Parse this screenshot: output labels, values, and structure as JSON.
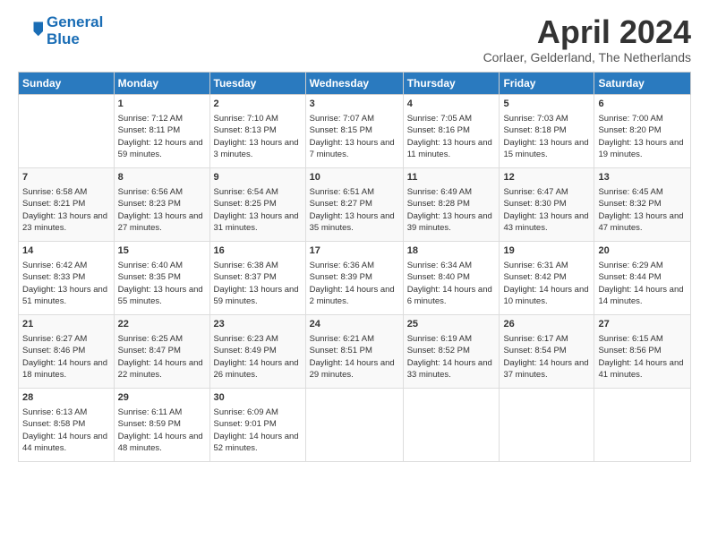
{
  "header": {
    "logo_line1": "General",
    "logo_line2": "Blue",
    "month_title": "April 2024",
    "subtitle": "Corlaer, Gelderland, The Netherlands"
  },
  "days_of_week": [
    "Sunday",
    "Monday",
    "Tuesday",
    "Wednesday",
    "Thursday",
    "Friday",
    "Saturday"
  ],
  "weeks": [
    [
      {
        "day": "",
        "sunrise": "",
        "sunset": "",
        "daylight": ""
      },
      {
        "day": "1",
        "sunrise": "Sunrise: 7:12 AM",
        "sunset": "Sunset: 8:11 PM",
        "daylight": "Daylight: 12 hours and 59 minutes."
      },
      {
        "day": "2",
        "sunrise": "Sunrise: 7:10 AM",
        "sunset": "Sunset: 8:13 PM",
        "daylight": "Daylight: 13 hours and 3 minutes."
      },
      {
        "day": "3",
        "sunrise": "Sunrise: 7:07 AM",
        "sunset": "Sunset: 8:15 PM",
        "daylight": "Daylight: 13 hours and 7 minutes."
      },
      {
        "day": "4",
        "sunrise": "Sunrise: 7:05 AM",
        "sunset": "Sunset: 8:16 PM",
        "daylight": "Daylight: 13 hours and 11 minutes."
      },
      {
        "day": "5",
        "sunrise": "Sunrise: 7:03 AM",
        "sunset": "Sunset: 8:18 PM",
        "daylight": "Daylight: 13 hours and 15 minutes."
      },
      {
        "day": "6",
        "sunrise": "Sunrise: 7:00 AM",
        "sunset": "Sunset: 8:20 PM",
        "daylight": "Daylight: 13 hours and 19 minutes."
      }
    ],
    [
      {
        "day": "7",
        "sunrise": "Sunrise: 6:58 AM",
        "sunset": "Sunset: 8:21 PM",
        "daylight": "Daylight: 13 hours and 23 minutes."
      },
      {
        "day": "8",
        "sunrise": "Sunrise: 6:56 AM",
        "sunset": "Sunset: 8:23 PM",
        "daylight": "Daylight: 13 hours and 27 minutes."
      },
      {
        "day": "9",
        "sunrise": "Sunrise: 6:54 AM",
        "sunset": "Sunset: 8:25 PM",
        "daylight": "Daylight: 13 hours and 31 minutes."
      },
      {
        "day": "10",
        "sunrise": "Sunrise: 6:51 AM",
        "sunset": "Sunset: 8:27 PM",
        "daylight": "Daylight: 13 hours and 35 minutes."
      },
      {
        "day": "11",
        "sunrise": "Sunrise: 6:49 AM",
        "sunset": "Sunset: 8:28 PM",
        "daylight": "Daylight: 13 hours and 39 minutes."
      },
      {
        "day": "12",
        "sunrise": "Sunrise: 6:47 AM",
        "sunset": "Sunset: 8:30 PM",
        "daylight": "Daylight: 13 hours and 43 minutes."
      },
      {
        "day": "13",
        "sunrise": "Sunrise: 6:45 AM",
        "sunset": "Sunset: 8:32 PM",
        "daylight": "Daylight: 13 hours and 47 minutes."
      }
    ],
    [
      {
        "day": "14",
        "sunrise": "Sunrise: 6:42 AM",
        "sunset": "Sunset: 8:33 PM",
        "daylight": "Daylight: 13 hours and 51 minutes."
      },
      {
        "day": "15",
        "sunrise": "Sunrise: 6:40 AM",
        "sunset": "Sunset: 8:35 PM",
        "daylight": "Daylight: 13 hours and 55 minutes."
      },
      {
        "day": "16",
        "sunrise": "Sunrise: 6:38 AM",
        "sunset": "Sunset: 8:37 PM",
        "daylight": "Daylight: 13 hours and 59 minutes."
      },
      {
        "day": "17",
        "sunrise": "Sunrise: 6:36 AM",
        "sunset": "Sunset: 8:39 PM",
        "daylight": "Daylight: 14 hours and 2 minutes."
      },
      {
        "day": "18",
        "sunrise": "Sunrise: 6:34 AM",
        "sunset": "Sunset: 8:40 PM",
        "daylight": "Daylight: 14 hours and 6 minutes."
      },
      {
        "day": "19",
        "sunrise": "Sunrise: 6:31 AM",
        "sunset": "Sunset: 8:42 PM",
        "daylight": "Daylight: 14 hours and 10 minutes."
      },
      {
        "day": "20",
        "sunrise": "Sunrise: 6:29 AM",
        "sunset": "Sunset: 8:44 PM",
        "daylight": "Daylight: 14 hours and 14 minutes."
      }
    ],
    [
      {
        "day": "21",
        "sunrise": "Sunrise: 6:27 AM",
        "sunset": "Sunset: 8:46 PM",
        "daylight": "Daylight: 14 hours and 18 minutes."
      },
      {
        "day": "22",
        "sunrise": "Sunrise: 6:25 AM",
        "sunset": "Sunset: 8:47 PM",
        "daylight": "Daylight: 14 hours and 22 minutes."
      },
      {
        "day": "23",
        "sunrise": "Sunrise: 6:23 AM",
        "sunset": "Sunset: 8:49 PM",
        "daylight": "Daylight: 14 hours and 26 minutes."
      },
      {
        "day": "24",
        "sunrise": "Sunrise: 6:21 AM",
        "sunset": "Sunset: 8:51 PM",
        "daylight": "Daylight: 14 hours and 29 minutes."
      },
      {
        "day": "25",
        "sunrise": "Sunrise: 6:19 AM",
        "sunset": "Sunset: 8:52 PM",
        "daylight": "Daylight: 14 hours and 33 minutes."
      },
      {
        "day": "26",
        "sunrise": "Sunrise: 6:17 AM",
        "sunset": "Sunset: 8:54 PM",
        "daylight": "Daylight: 14 hours and 37 minutes."
      },
      {
        "day": "27",
        "sunrise": "Sunrise: 6:15 AM",
        "sunset": "Sunset: 8:56 PM",
        "daylight": "Daylight: 14 hours and 41 minutes."
      }
    ],
    [
      {
        "day": "28",
        "sunrise": "Sunrise: 6:13 AM",
        "sunset": "Sunset: 8:58 PM",
        "daylight": "Daylight: 14 hours and 44 minutes."
      },
      {
        "day": "29",
        "sunrise": "Sunrise: 6:11 AM",
        "sunset": "Sunset: 8:59 PM",
        "daylight": "Daylight: 14 hours and 48 minutes."
      },
      {
        "day": "30",
        "sunrise": "Sunrise: 6:09 AM",
        "sunset": "Sunset: 9:01 PM",
        "daylight": "Daylight: 14 hours and 52 minutes."
      },
      {
        "day": "",
        "sunrise": "",
        "sunset": "",
        "daylight": ""
      },
      {
        "day": "",
        "sunrise": "",
        "sunset": "",
        "daylight": ""
      },
      {
        "day": "",
        "sunrise": "",
        "sunset": "",
        "daylight": ""
      },
      {
        "day": "",
        "sunrise": "",
        "sunset": "",
        "daylight": ""
      }
    ]
  ]
}
